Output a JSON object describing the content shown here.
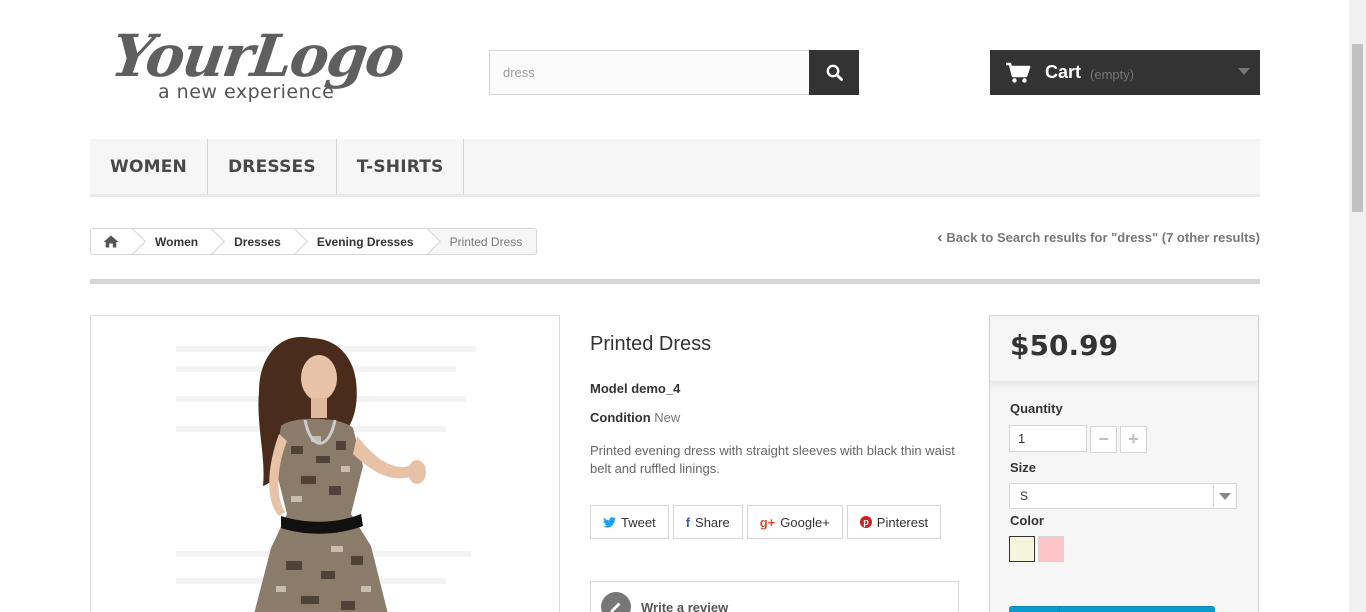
{
  "header": {
    "logo": {
      "main": "YourLogo",
      "tagline": "a new experience"
    },
    "search": {
      "value": "dress",
      "button_icon": "search-icon"
    },
    "cart": {
      "label": "Cart",
      "status": "(empty)",
      "icon": "cart-icon"
    }
  },
  "menu": {
    "items": [
      {
        "label": "WOMEN"
      },
      {
        "label": "DRESSES"
      },
      {
        "label": "T-SHIRTS"
      }
    ]
  },
  "breadcrumb": {
    "home_icon": "home-icon",
    "items": [
      {
        "label": "Women"
      },
      {
        "label": "Dresses"
      },
      {
        "label": "Evening Dresses"
      },
      {
        "label": "Printed Dress"
      }
    ]
  },
  "back_link": "Back to Search results for \"dress\" (7 other results)",
  "product": {
    "title": "Printed Dress",
    "model_label": "Model",
    "model_value": "demo_4",
    "condition_label": "Condition",
    "condition_value": "New",
    "description": "Printed evening dress with straight sleeves with black thin waist belt and ruffled linings.",
    "social": [
      {
        "icon": "twitter-icon",
        "glyph": "🐦",
        "label": "Tweet"
      },
      {
        "icon": "facebook-icon",
        "glyph": "f",
        "label": "Share"
      },
      {
        "icon": "google-plus-icon",
        "glyph": "g+",
        "label": "Google+"
      },
      {
        "icon": "pinterest-icon",
        "glyph": "ⓟ",
        "label": "Pinterest"
      }
    ],
    "review_link": "Write a review"
  },
  "buy_box": {
    "price": "$50.99",
    "quantity_label": "Quantity",
    "quantity_value": "1",
    "size_label": "Size",
    "size_value": "S",
    "color_label": "Color",
    "colors": [
      "#f5f5dc",
      "#fcc6c8"
    ]
  },
  "colors": {
    "dark": "#333333",
    "menu_bg": "#f6f6f6",
    "accent_blue": "#0d9acd"
  }
}
